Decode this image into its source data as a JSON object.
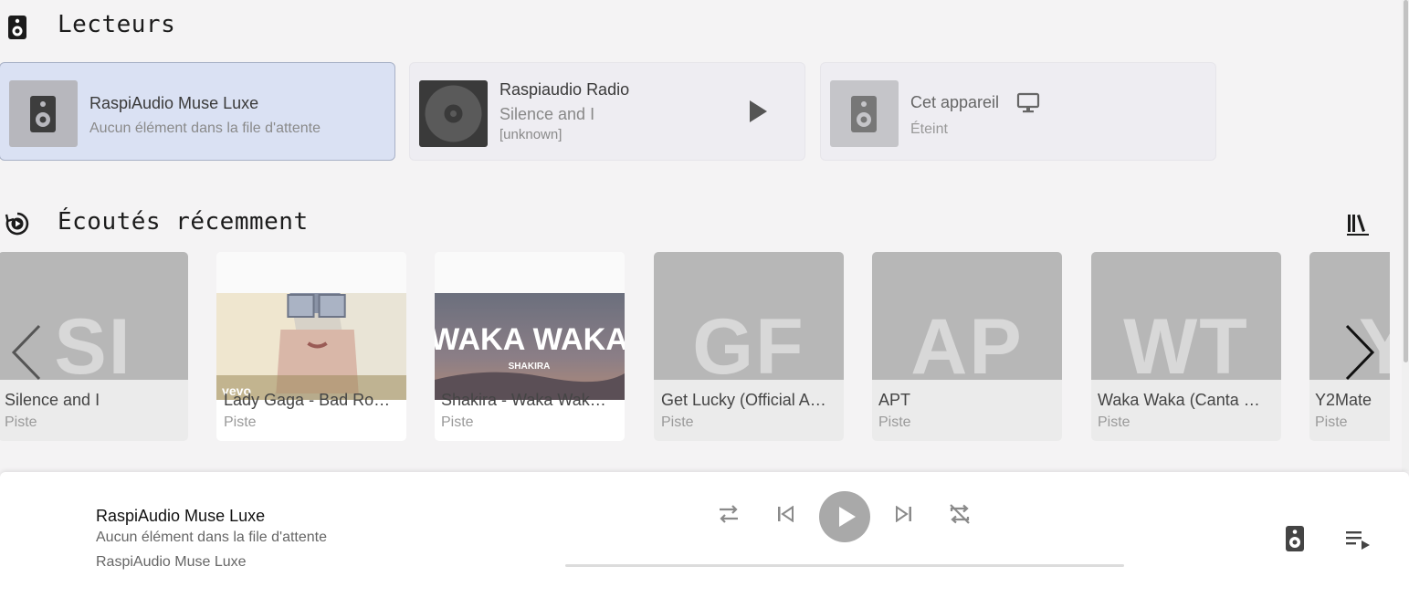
{
  "players_section": {
    "title": "Lecteurs"
  },
  "players": [
    {
      "name": "RaspiAudio Muse Luxe",
      "line1": "Aucun élément dans la file d'attente",
      "active": true
    },
    {
      "name": "Raspiaudio Radio",
      "line1": "Silence and I",
      "line2": "[unknown]"
    },
    {
      "name": "Cet appareil",
      "line1": "Éteint"
    }
  ],
  "recent_section": {
    "title": "Écoutés récemment"
  },
  "recent_items": [
    {
      "initials": "SI",
      "title": "Silence and I",
      "type": "Piste"
    },
    {
      "title": "Lady Gaga - Bad Ro…",
      "type": "Piste",
      "art_text": "vevo"
    },
    {
      "title": "Shakira - Waka Wak…",
      "type": "Piste",
      "art_text": "WAKA WAKA",
      "art_subtext": "SHAKIRA"
    },
    {
      "initials": "GF",
      "title": "Get Lucky (Official A…",
      "type": "Piste"
    },
    {
      "initials": "AP",
      "title": "APT",
      "type": "Piste"
    },
    {
      "initials": "WT",
      "title": "Waka Waka (Canta C…",
      "type": "Piste"
    },
    {
      "initials": "Y",
      "title": "Y2Mate",
      "type": "Piste"
    }
  ],
  "now_playing": {
    "player": "RaspiAudio Muse Luxe",
    "status": "Aucun élément dans la file d'attente",
    "device": "RaspiAudio Muse Luxe"
  },
  "colors": {
    "active_card": "#dae1f3",
    "tile_placeholder": "#b7b7b7",
    "play_button": "#a9a9a9"
  }
}
